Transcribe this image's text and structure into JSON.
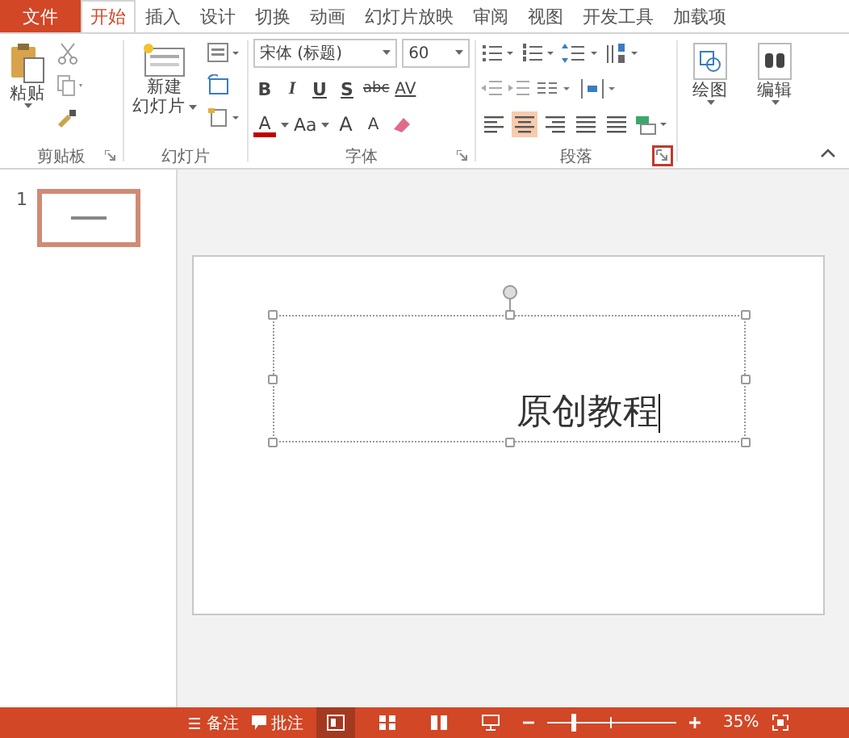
{
  "tabs": [
    {
      "label": "文件",
      "kind": "file",
      "selected": false
    },
    {
      "label": "开始",
      "kind": "tab",
      "selected": true
    },
    {
      "label": "插入",
      "kind": "tab",
      "selected": false
    },
    {
      "label": "设计",
      "kind": "tab",
      "selected": false
    },
    {
      "label": "切换",
      "kind": "tab",
      "selected": false
    },
    {
      "label": "动画",
      "kind": "tab",
      "selected": false
    },
    {
      "label": "幻灯片放映",
      "kind": "tab",
      "selected": false
    },
    {
      "label": "审阅",
      "kind": "tab",
      "selected": false
    },
    {
      "label": "视图",
      "kind": "tab",
      "selected": false
    },
    {
      "label": "开发工具",
      "kind": "tab",
      "selected": false
    },
    {
      "label": "加载项",
      "kind": "tab",
      "selected": false
    }
  ],
  "ribbon": {
    "clipboard": {
      "label": "剪贴板",
      "paste": "粘贴"
    },
    "slides": {
      "label": "幻灯片",
      "new_slide_top": "新建",
      "new_slide_bottom": "幻灯片"
    },
    "font": {
      "label": "字体",
      "family": "宋体 (标题)",
      "size": "60",
      "format_buttons": [
        "B",
        "I",
        "U",
        "S",
        "abc",
        "AV"
      ],
      "color_button": "A",
      "case_button": "Aa",
      "grow_button": "A",
      "shrink_button": "A"
    },
    "paragraph": {
      "label": "段落",
      "launcher_highlighted": true,
      "align_buttons": [
        {
          "kind": "left",
          "selected": false
        },
        {
          "kind": "center",
          "selected": true
        },
        {
          "kind": "right",
          "selected": false
        },
        {
          "kind": "justify",
          "selected": false
        },
        {
          "kind": "distributed",
          "selected": false
        }
      ]
    },
    "drawing": {
      "label": "绘图"
    },
    "editing": {
      "label": "编辑"
    }
  },
  "thumbnails": [
    {
      "number": "1",
      "selected": true
    }
  ],
  "slide": {
    "text": "原创教程"
  },
  "status_bar": {
    "notes": "备注",
    "comments": "批注",
    "views": [
      {
        "kind": "normal",
        "selected": true
      },
      {
        "kind": "sorter",
        "selected": false
      },
      {
        "kind": "reading",
        "selected": false
      },
      {
        "kind": "slideshow",
        "selected": false
      }
    ],
    "zoom": "35%",
    "level": 0.2
  }
}
